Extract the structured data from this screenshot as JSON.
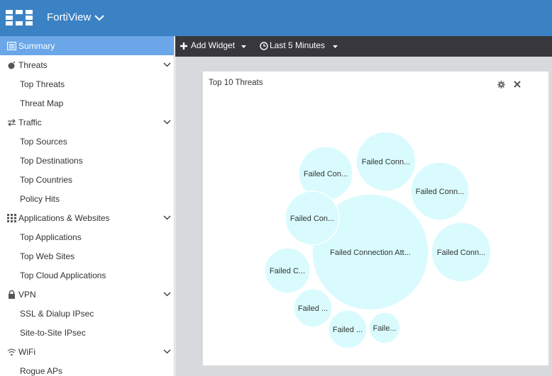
{
  "header": {
    "app_title": "FortiView"
  },
  "sidebar": {
    "summary": "Summary",
    "threats": {
      "label": "Threats",
      "items": [
        "Top Threats",
        "Threat Map"
      ]
    },
    "traffic": {
      "label": "Traffic",
      "items": [
        "Top Sources",
        "Top Destinations",
        "Top Countries",
        "Policy Hits"
      ]
    },
    "apps": {
      "label": "Applications & Websites",
      "items": [
        "Top Applications",
        "Top Web Sites",
        "Top Cloud Applications"
      ]
    },
    "vpn": {
      "label": "VPN",
      "items": [
        "SSL & Dialup IPsec",
        "Site-to-Site IPsec"
      ]
    },
    "wifi": {
      "label": "WiFi",
      "items": [
        "Rogue APs"
      ]
    }
  },
  "toolbar": {
    "add_widget": "Add Widget",
    "time_range": "Last 5 Minutes"
  },
  "widget": {
    "title": "Top 10 Threats"
  },
  "chart_data": {
    "type": "bubble",
    "title": "Top 10 Threats",
    "bubbles": [
      {
        "label": "Failed Connection Att...",
        "size": 100
      },
      {
        "label": "Failed Conn...",
        "size": 28
      },
      {
        "label": "Failed Conn...",
        "size": 26
      },
      {
        "label": "Failed Conn...",
        "size": 26
      },
      {
        "label": "Failed Con...",
        "size": 22
      },
      {
        "label": "Failed Con...",
        "size": 22
      },
      {
        "label": "Failed C...",
        "size": 15
      },
      {
        "label": "Failed ...",
        "size": 10
      },
      {
        "label": "Failed ...",
        "size": 9
      },
      {
        "label": "Faile...",
        "size": 7
      }
    ]
  }
}
